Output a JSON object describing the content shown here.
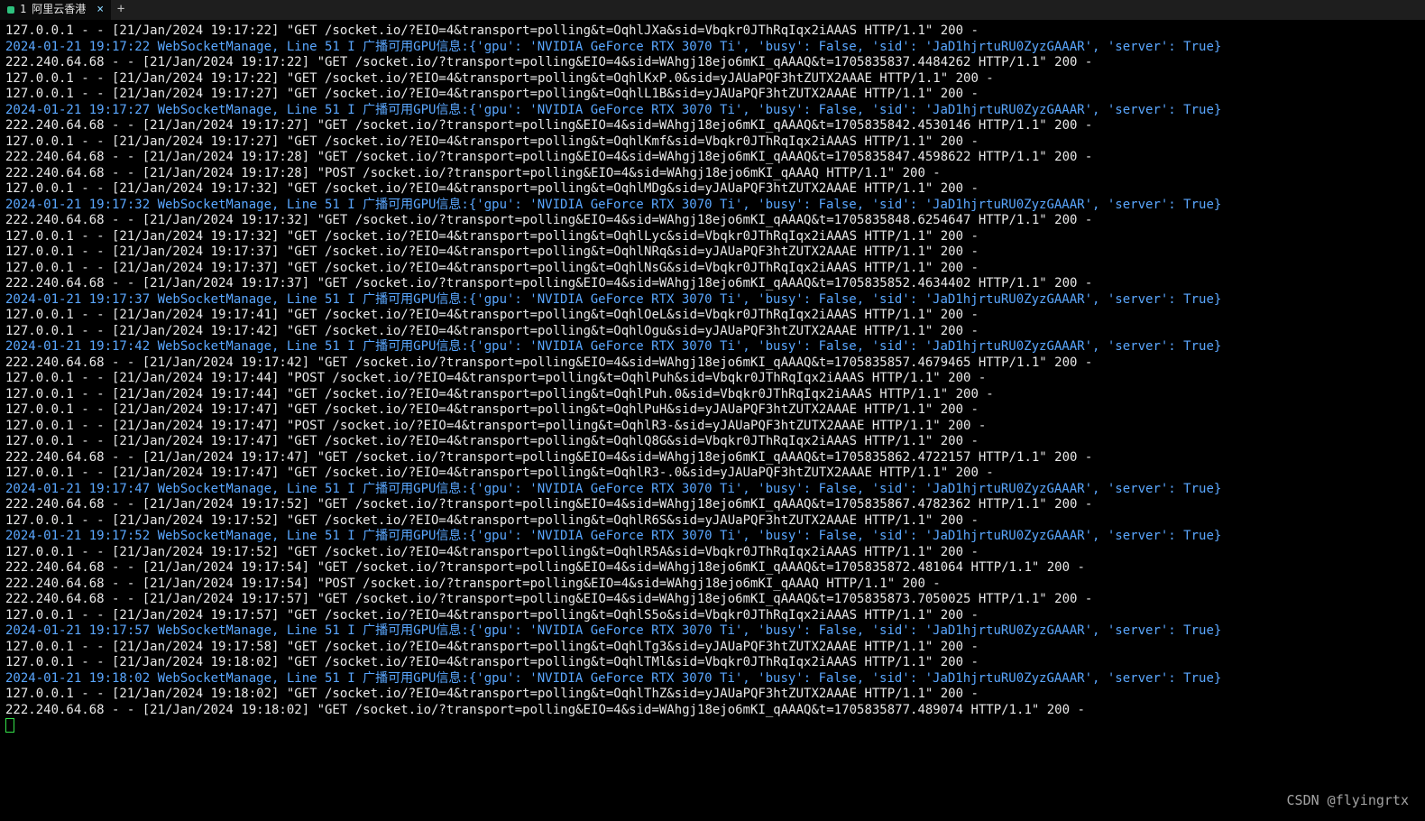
{
  "tab": {
    "index": "1",
    "title": "阿里云香港",
    "close": "×",
    "new": "+"
  },
  "watermark": "CSDN @flyingrtx",
  "lines": [
    {
      "c": "w",
      "t": "127.0.0.1 - - [21/Jan/2024 19:17:22] \"GET /socket.io/?EIO=4&transport=polling&t=OqhlJXa&sid=Vbqkr0JThRqIqx2iAAAS HTTP/1.1\" 200 -"
    },
    {
      "c": "b",
      "t": "2024-01-21 19:17:22 WebSocketManage, Line 51 I 广播可用GPU信息:{'gpu': 'NVIDIA GeForce RTX 3070 Ti', 'busy': False, 'sid': 'JaD1hjrtuRU0ZyzGAAAR', 'server': True}"
    },
    {
      "c": "w",
      "t": "222.240.64.68 - - [21/Jan/2024 19:17:22] \"GET /socket.io/?transport=polling&EIO=4&sid=WAhgj18ejo6mKI_qAAAQ&t=1705835837.4484262 HTTP/1.1\" 200 -"
    },
    {
      "c": "w",
      "t": "127.0.0.1 - - [21/Jan/2024 19:17:22] \"GET /socket.io/?EIO=4&transport=polling&t=OqhlKxP.0&sid=yJAUaPQF3htZUTX2AAAE HTTP/1.1\" 200 -"
    },
    {
      "c": "w",
      "t": "127.0.0.1 - - [21/Jan/2024 19:17:27] \"GET /socket.io/?EIO=4&transport=polling&t=OqhlL1B&sid=yJAUaPQF3htZUTX2AAAE HTTP/1.1\" 200 -"
    },
    {
      "c": "b",
      "t": "2024-01-21 19:17:27 WebSocketManage, Line 51 I 广播可用GPU信息:{'gpu': 'NVIDIA GeForce RTX 3070 Ti', 'busy': False, 'sid': 'JaD1hjrtuRU0ZyzGAAAR', 'server': True}"
    },
    {
      "c": "w",
      "t": "222.240.64.68 - - [21/Jan/2024 19:17:27] \"GET /socket.io/?transport=polling&EIO=4&sid=WAhgj18ejo6mKI_qAAAQ&t=1705835842.4530146 HTTP/1.1\" 200 -"
    },
    {
      "c": "w",
      "t": "127.0.0.1 - - [21/Jan/2024 19:17:27] \"GET /socket.io/?EIO=4&transport=polling&t=OqhlKmf&sid=Vbqkr0JThRqIqx2iAAAS HTTP/1.1\" 200 -"
    },
    {
      "c": "w",
      "t": "222.240.64.68 - - [21/Jan/2024 19:17:28] \"GET /socket.io/?transport=polling&EIO=4&sid=WAhgj18ejo6mKI_qAAAQ&t=1705835847.4598622 HTTP/1.1\" 200 -"
    },
    {
      "c": "w",
      "t": "222.240.64.68 - - [21/Jan/2024 19:17:28] \"POST /socket.io/?transport=polling&EIO=4&sid=WAhgj18ejo6mKI_qAAAQ HTTP/1.1\" 200 -"
    },
    {
      "c": "w",
      "t": "127.0.0.1 - - [21/Jan/2024 19:17:32] \"GET /socket.io/?EIO=4&transport=polling&t=OqhlMDg&sid=yJAUaPQF3htZUTX2AAAE HTTP/1.1\" 200 -"
    },
    {
      "c": "b",
      "t": "2024-01-21 19:17:32 WebSocketManage, Line 51 I 广播可用GPU信息:{'gpu': 'NVIDIA GeForce RTX 3070 Ti', 'busy': False, 'sid': 'JaD1hjrtuRU0ZyzGAAAR', 'server': True}"
    },
    {
      "c": "w",
      "t": "222.240.64.68 - - [21/Jan/2024 19:17:32] \"GET /socket.io/?transport=polling&EIO=4&sid=WAhgj18ejo6mKI_qAAAQ&t=1705835848.6254647 HTTP/1.1\" 200 -"
    },
    {
      "c": "w",
      "t": "127.0.0.1 - - [21/Jan/2024 19:17:32] \"GET /socket.io/?EIO=4&transport=polling&t=OqhlLyc&sid=Vbqkr0JThRqIqx2iAAAS HTTP/1.1\" 200 -"
    },
    {
      "c": "w",
      "t": "127.0.0.1 - - [21/Jan/2024 19:17:37] \"GET /socket.io/?EIO=4&transport=polling&t=OqhlNRq&sid=yJAUaPQF3htZUTX2AAAE HTTP/1.1\" 200 -"
    },
    {
      "c": "w",
      "t": "127.0.0.1 - - [21/Jan/2024 19:17:37] \"GET /socket.io/?EIO=4&transport=polling&t=OqhlNsG&sid=Vbqkr0JThRqIqx2iAAAS HTTP/1.1\" 200 -"
    },
    {
      "c": "w",
      "t": "222.240.64.68 - - [21/Jan/2024 19:17:37] \"GET /socket.io/?transport=polling&EIO=4&sid=WAhgj18ejo6mKI_qAAAQ&t=1705835852.4634402 HTTP/1.1\" 200 -"
    },
    {
      "c": "b",
      "t": "2024-01-21 19:17:37 WebSocketManage, Line 51 I 广播可用GPU信息:{'gpu': 'NVIDIA GeForce RTX 3070 Ti', 'busy': False, 'sid': 'JaD1hjrtuRU0ZyzGAAAR', 'server': True}"
    },
    {
      "c": "w",
      "t": "127.0.0.1 - - [21/Jan/2024 19:17:41] \"GET /socket.io/?EIO=4&transport=polling&t=OqhlOeL&sid=Vbqkr0JThRqIqx2iAAAS HTTP/1.1\" 200 -"
    },
    {
      "c": "w",
      "t": "127.0.0.1 - - [21/Jan/2024 19:17:42] \"GET /socket.io/?EIO=4&transport=polling&t=OqhlOgu&sid=yJAUaPQF3htZUTX2AAAE HTTP/1.1\" 200 -"
    },
    {
      "c": "b",
      "t": "2024-01-21 19:17:42 WebSocketManage, Line 51 I 广播可用GPU信息:{'gpu': 'NVIDIA GeForce RTX 3070 Ti', 'busy': False, 'sid': 'JaD1hjrtuRU0ZyzGAAAR', 'server': True}"
    },
    {
      "c": "w",
      "t": "222.240.64.68 - - [21/Jan/2024 19:17:42] \"GET /socket.io/?transport=polling&EIO=4&sid=WAhgj18ejo6mKI_qAAAQ&t=1705835857.4679465 HTTP/1.1\" 200 -"
    },
    {
      "c": "w",
      "t": "127.0.0.1 - - [21/Jan/2024 19:17:44] \"POST /socket.io/?EIO=4&transport=polling&t=OqhlPuh&sid=Vbqkr0JThRqIqx2iAAAS HTTP/1.1\" 200 -"
    },
    {
      "c": "w",
      "t": "127.0.0.1 - - [21/Jan/2024 19:17:44] \"GET /socket.io/?EIO=4&transport=polling&t=OqhlPuh.0&sid=Vbqkr0JThRqIqx2iAAAS HTTP/1.1\" 200 -"
    },
    {
      "c": "w",
      "t": "127.0.0.1 - - [21/Jan/2024 19:17:47] \"GET /socket.io/?EIO=4&transport=polling&t=OqhlPuH&sid=yJAUaPQF3htZUTX2AAAE HTTP/1.1\" 200 -"
    },
    {
      "c": "w",
      "t": "127.0.0.1 - - [21/Jan/2024 19:17:47] \"POST /socket.io/?EIO=4&transport=polling&t=OqhlR3-&sid=yJAUaPQF3htZUTX2AAAE HTTP/1.1\" 200 -"
    },
    {
      "c": "w",
      "t": "127.0.0.1 - - [21/Jan/2024 19:17:47] \"GET /socket.io/?EIO=4&transport=polling&t=OqhlQ8G&sid=Vbqkr0JThRqIqx2iAAAS HTTP/1.1\" 200 -"
    },
    {
      "c": "w",
      "t": "222.240.64.68 - - [21/Jan/2024 19:17:47] \"GET /socket.io/?transport=polling&EIO=4&sid=WAhgj18ejo6mKI_qAAAQ&t=1705835862.4722157 HTTP/1.1\" 200 -"
    },
    {
      "c": "w",
      "t": "127.0.0.1 - - [21/Jan/2024 19:17:47] \"GET /socket.io/?EIO=4&transport=polling&t=OqhlR3-.0&sid=yJAUaPQF3htZUTX2AAAE HTTP/1.1\" 200 -"
    },
    {
      "c": "b",
      "t": "2024-01-21 19:17:47 WebSocketManage, Line 51 I 广播可用GPU信息:{'gpu': 'NVIDIA GeForce RTX 3070 Ti', 'busy': False, 'sid': 'JaD1hjrtuRU0ZyzGAAAR', 'server': True}"
    },
    {
      "c": "w",
      "t": "222.240.64.68 - - [21/Jan/2024 19:17:52] \"GET /socket.io/?transport=polling&EIO=4&sid=WAhgj18ejo6mKI_qAAAQ&t=1705835867.4782362 HTTP/1.1\" 200 -"
    },
    {
      "c": "w",
      "t": "127.0.0.1 - - [21/Jan/2024 19:17:52] \"GET /socket.io/?EIO=4&transport=polling&t=OqhlR6S&sid=yJAUaPQF3htZUTX2AAAE HTTP/1.1\" 200 -"
    },
    {
      "c": "b",
      "t": "2024-01-21 19:17:52 WebSocketManage, Line 51 I 广播可用GPU信息:{'gpu': 'NVIDIA GeForce RTX 3070 Ti', 'busy': False, 'sid': 'JaD1hjrtuRU0ZyzGAAAR', 'server': True}"
    },
    {
      "c": "w",
      "t": "127.0.0.1 - - [21/Jan/2024 19:17:52] \"GET /socket.io/?EIO=4&transport=polling&t=OqhlR5A&sid=Vbqkr0JThRqIqx2iAAAS HTTP/1.1\" 200 -"
    },
    {
      "c": "w",
      "t": "222.240.64.68 - - [21/Jan/2024 19:17:54] \"GET /socket.io/?transport=polling&EIO=4&sid=WAhgj18ejo6mKI_qAAAQ&t=1705835872.481064 HTTP/1.1\" 200 -"
    },
    {
      "c": "w",
      "t": "222.240.64.68 - - [21/Jan/2024 19:17:54] \"POST /socket.io/?transport=polling&EIO=4&sid=WAhgj18ejo6mKI_qAAAQ HTTP/1.1\" 200 -"
    },
    {
      "c": "w",
      "t": "222.240.64.68 - - [21/Jan/2024 19:17:57] \"GET /socket.io/?transport=polling&EIO=4&sid=WAhgj18ejo6mKI_qAAAQ&t=1705835873.7050025 HTTP/1.1\" 200 -"
    },
    {
      "c": "w",
      "t": "127.0.0.1 - - [21/Jan/2024 19:17:57] \"GET /socket.io/?EIO=4&transport=polling&t=OqhlS5o&sid=Vbqkr0JThRqIqx2iAAAS HTTP/1.1\" 200 -"
    },
    {
      "c": "b",
      "t": "2024-01-21 19:17:57 WebSocketManage, Line 51 I 广播可用GPU信息:{'gpu': 'NVIDIA GeForce RTX 3070 Ti', 'busy': False, 'sid': 'JaD1hjrtuRU0ZyzGAAAR', 'server': True}"
    },
    {
      "c": "w",
      "t": "127.0.0.1 - - [21/Jan/2024 19:17:58] \"GET /socket.io/?EIO=4&transport=polling&t=OqhlTg3&sid=yJAUaPQF3htZUTX2AAAE HTTP/1.1\" 200 -"
    },
    {
      "c": "w",
      "t": "127.0.0.1 - - [21/Jan/2024 19:18:02] \"GET /socket.io/?EIO=4&transport=polling&t=OqhlTMl&sid=Vbqkr0JThRqIqx2iAAAS HTTP/1.1\" 200 -"
    },
    {
      "c": "b",
      "t": "2024-01-21 19:18:02 WebSocketManage, Line 51 I 广播可用GPU信息:{'gpu': 'NVIDIA GeForce RTX 3070 Ti', 'busy': False, 'sid': 'JaD1hjrtuRU0ZyzGAAAR', 'server': True}"
    },
    {
      "c": "w",
      "t": "127.0.0.1 - - [21/Jan/2024 19:18:02] \"GET /socket.io/?EIO=4&transport=polling&t=OqhlThZ&sid=yJAUaPQF3htZUTX2AAAE HTTP/1.1\" 200 -"
    },
    {
      "c": "w",
      "t": "222.240.64.68 - - [21/Jan/2024 19:18:02] \"GET /socket.io/?transport=polling&EIO=4&sid=WAhgj18ejo6mKI_qAAAQ&t=1705835877.489074 HTTP/1.1\" 200 -"
    }
  ]
}
